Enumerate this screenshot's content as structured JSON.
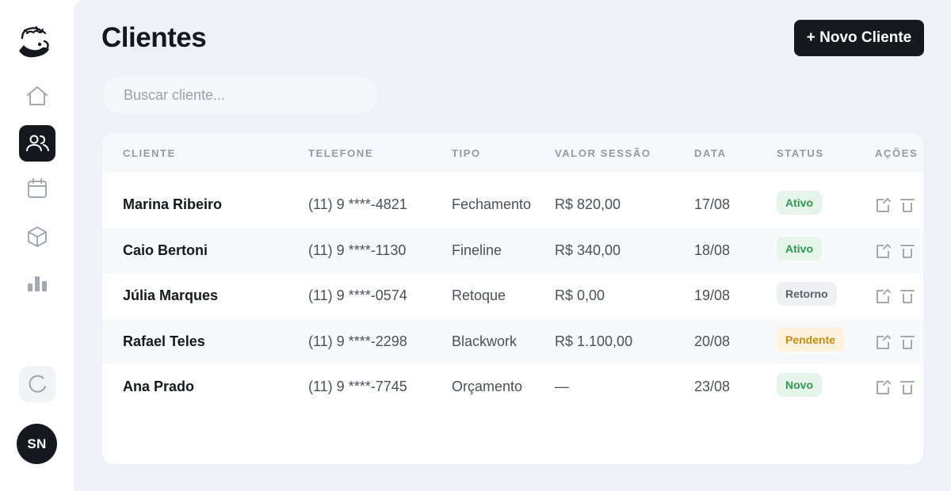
{
  "sidebar": {
    "user_initials": "SN",
    "nav": [
      {
        "icon": "home-icon",
        "active": false
      },
      {
        "icon": "users-icon",
        "active": true
      },
      {
        "icon": "calendar-icon",
        "active": false
      },
      {
        "icon": "box-icon",
        "active": false
      },
      {
        "icon": "bar-chart-icon",
        "active": false
      }
    ]
  },
  "header": {
    "title": "Clientes",
    "new_button": "+ Novo Cliente"
  },
  "search": {
    "placeholder": "Buscar cliente..."
  },
  "table": {
    "columns": [
      "CLIENTE",
      "TELEFONE",
      "TIPO",
      "VALOR SESSÃO",
      "DATA",
      "STATUS",
      "AÇÕES"
    ],
    "rows": [
      {
        "name": "Marina Ribeiro",
        "phone": "(11) 9 ****-4821",
        "type": "Fechamento",
        "value": "R$ 820,00",
        "date": "17/08",
        "status": "Ativo",
        "status_kind": "ativo"
      },
      {
        "name": "Caio Bertoni",
        "phone": "(11) 9 ****-1130",
        "type": "Fineline",
        "value": "R$ 340,00",
        "date": "18/08",
        "status": "Ativo",
        "status_kind": "ativo"
      },
      {
        "name": "Júlia Marques",
        "phone": "(11) 9 ****-0574",
        "type": "Retoque",
        "value": "R$ 0,00",
        "date": "19/08",
        "status": "Retorno",
        "status_kind": "retorno"
      },
      {
        "name": "Rafael Teles",
        "phone": "(11) 9 ****-2298",
        "type": "Blackwork",
        "value": "R$ 1.100,00",
        "date": "20/08",
        "status": "Pendente",
        "status_kind": "pendente"
      },
      {
        "name": "Ana Prado",
        "phone": "(11) 9 ****-7745",
        "type": "Orçamento",
        "value": "—",
        "date": "23/08",
        "status": "Novo",
        "status_kind": "novo"
      }
    ]
  },
  "colors": {
    "accent": "#16181d",
    "background": "#eef1f6",
    "status_ok": "#2f9a4f",
    "status_pending": "#c98b10"
  }
}
